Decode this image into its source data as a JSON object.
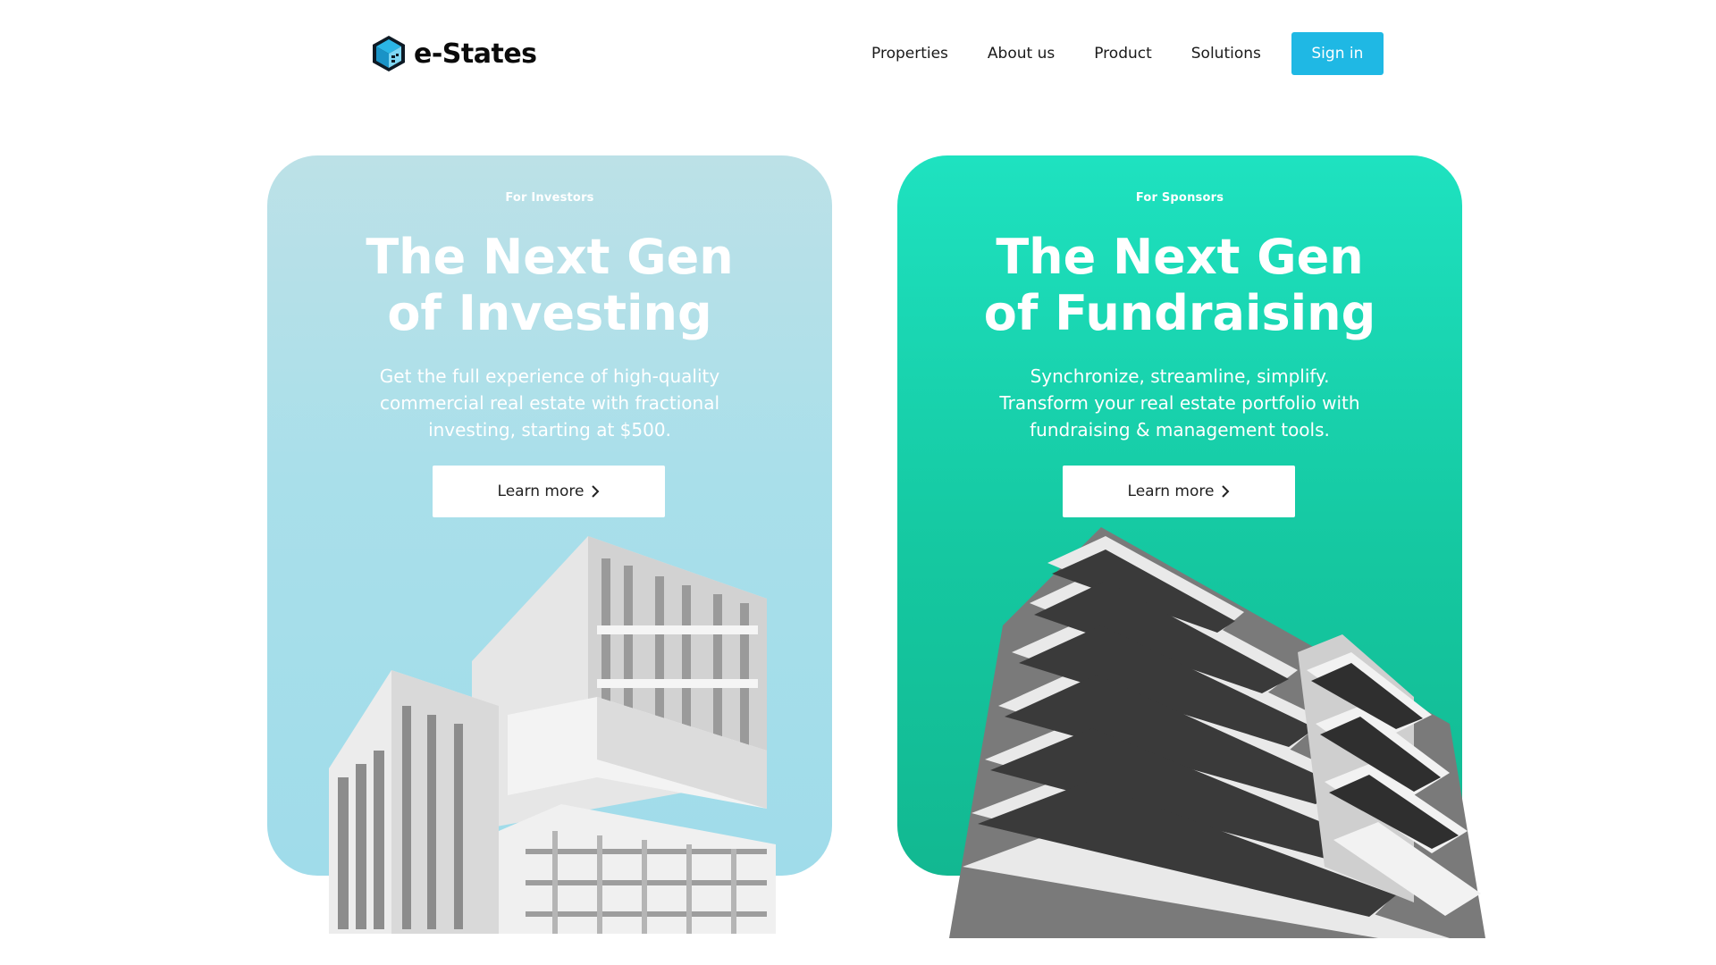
{
  "brand": {
    "name": "e-States"
  },
  "nav": {
    "items": [
      "Properties",
      "About us",
      "Product",
      "Solutions"
    ],
    "signin_label": "Sign in"
  },
  "cards": [
    {
      "eyebrow": "For Investors",
      "title_line1": "The Next Gen",
      "title_line2": "of Investing",
      "desc_line1": "Get the full experience of high-quality",
      "desc_line2": "commercial real estate with fractional",
      "desc_line3": "investing, starting at $500.",
      "cta": "Learn more"
    },
    {
      "eyebrow": "For Sponsors",
      "title_line1": "The Next Gen",
      "title_line2": "of Fundraising",
      "desc_line1": "Synchronize, streamline, simplify.",
      "desc_line2": "Transform your real estate portfolio with",
      "desc_line3": "fundraising & management tools.",
      "cta": "Learn more"
    }
  ],
  "colors": {
    "accent": "#1fb8e4",
    "investors_card": "#a9dfea",
    "sponsors_card": "#15c8a1"
  }
}
